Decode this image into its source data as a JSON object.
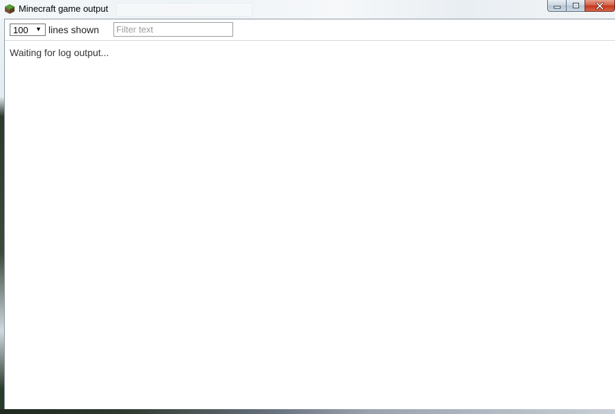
{
  "window": {
    "title": "Minecraft game output",
    "icon": "minecraft-grass-block-icon",
    "controls": {
      "minimize_icon": "minimize-icon",
      "maximize_icon": "maximize-icon",
      "close_icon": "close-icon"
    }
  },
  "toolbar": {
    "lines_select": {
      "selected": "100"
    },
    "lines_label": "lines shown",
    "filter": {
      "placeholder": "Filter text",
      "value": ""
    }
  },
  "log": {
    "status_text": "Waiting for log output..."
  },
  "colors": {
    "close_button": "#c2361b",
    "caption_buttons": "#c8d4de",
    "client_background": "#ffffff"
  }
}
